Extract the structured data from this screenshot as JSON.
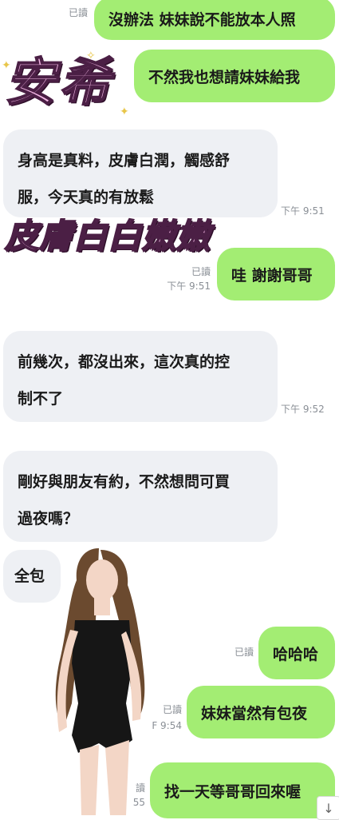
{
  "messages": {
    "m1": {
      "text": "沒辦法 妹妹說不能放本人照",
      "read": "已讀"
    },
    "m2": {
      "text": "不然我也想請妹妹給我"
    },
    "m3": {
      "line1": "身高是真料，皮膚白潤，觸感舒",
      "line2": "服，今天真的有放鬆",
      "time": "下午 9:51"
    },
    "m4": {
      "text": "哇 謝謝哥哥",
      "read": "已讀",
      "time": "下午 9:51"
    },
    "m5": {
      "line1": "前幾次，都沒出來，這次真的控",
      "line2": "制不了",
      "time": "下午 9:52"
    },
    "m6": {
      "line1": "剛好與朋友有約，不然想問可買",
      "line2": "過夜嗎？"
    },
    "m7": {
      "text": "全包"
    },
    "m8": {
      "text": "哈哈哈",
      "read": "已讀"
    },
    "m9": {
      "text": "妹妹當然有包夜",
      "read": "已讀",
      "time": "F 9:54"
    },
    "m10": {
      "text": "找一天等哥哥回來喔",
      "read": "讀",
      "time": "55"
    }
  },
  "overlay": {
    "name": "安希",
    "tagline": "皮膚白白嫩嫩"
  },
  "colors": {
    "outgoing_bubble": "#a3ed73",
    "incoming_bubble": "#eef0f4",
    "overlay_pink": "#f4b8e6"
  },
  "icons": {
    "scroll_down": "arrow-down-icon",
    "sparkle": "sparkle-icon"
  }
}
